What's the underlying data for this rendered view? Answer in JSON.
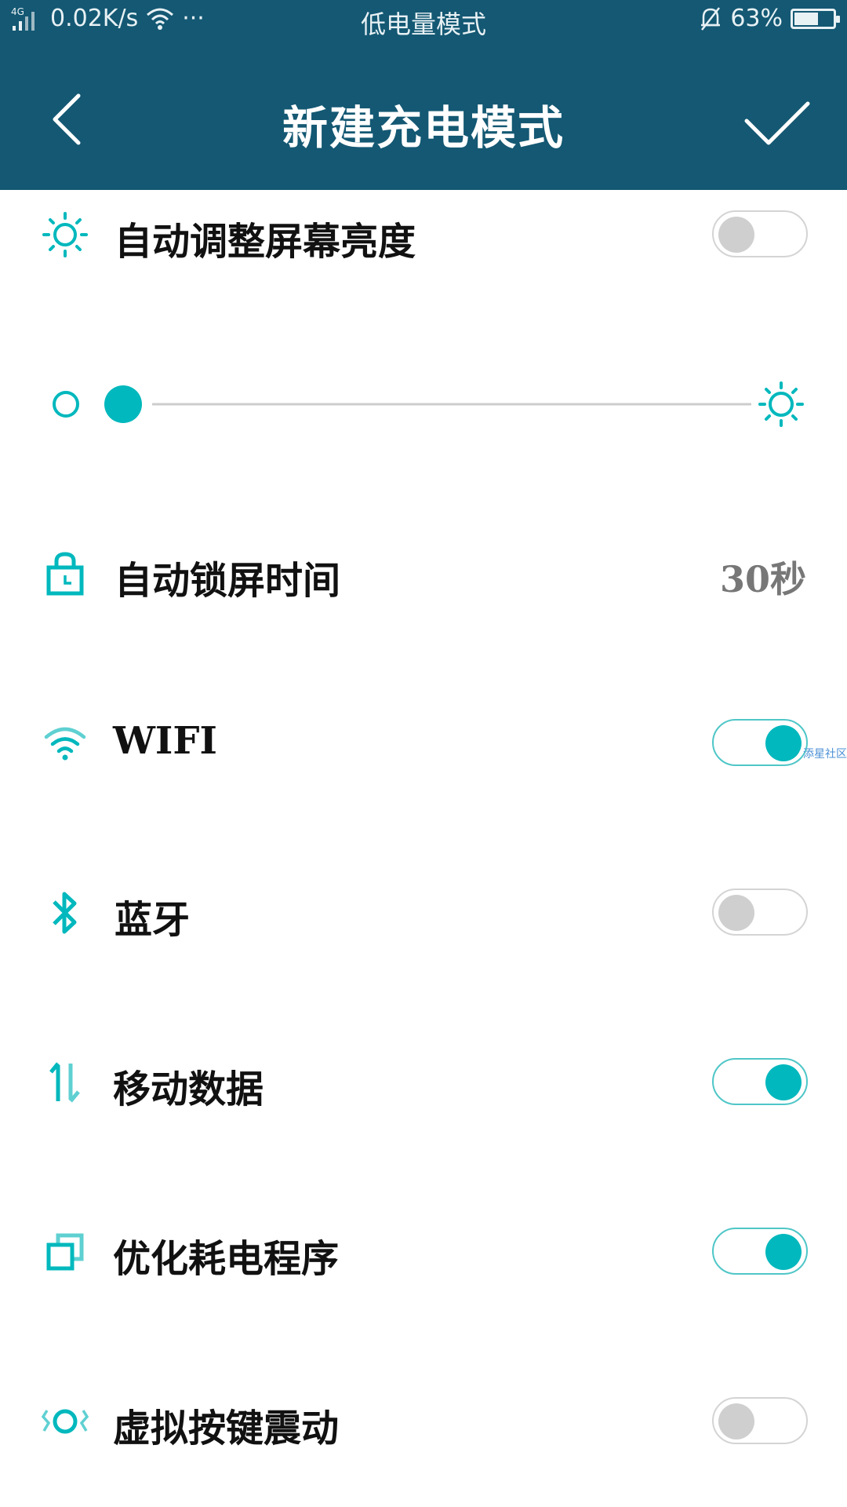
{
  "status_bar": {
    "network": "4G",
    "speed": "0.02K/s",
    "more": "···",
    "center_text": "低电量模式",
    "battery_percent": "63%",
    "battery_level": 0.63
  },
  "header": {
    "title": "新建充电模式",
    "back_icon": "chevron-left-icon",
    "confirm_icon": "checkmark-icon"
  },
  "settings": {
    "auto_brightness": {
      "label": "自动调整屏幕亮度",
      "enabled": false,
      "icon": "sun-icon"
    },
    "brightness_slider": {
      "level": 0.0,
      "min_icon": "dim-circle-icon",
      "max_icon": "sun-icon"
    },
    "auto_lock": {
      "label": "自动锁屏时间",
      "value": "30秒",
      "icon": "lock-icon"
    },
    "wifi": {
      "label": "WIFI",
      "enabled": true,
      "icon": "wifi-icon"
    },
    "bluetooth": {
      "label": "蓝牙",
      "enabled": false,
      "icon": "bluetooth-icon"
    },
    "mobile_data": {
      "label": "移动数据",
      "enabled": true,
      "icon": "data-arrows-icon"
    },
    "optimize_apps": {
      "label": "优化耗电程序",
      "enabled": true,
      "icon": "apps-stack-icon"
    },
    "key_vibration": {
      "label": "虚拟按键震动",
      "enabled": false,
      "icon": "vibration-icon"
    }
  },
  "watermark": "添星社区",
  "colors": {
    "header_bg": "#145873",
    "accent": "#00b8bd",
    "toggle_off_knob": "#cfcfcf"
  }
}
